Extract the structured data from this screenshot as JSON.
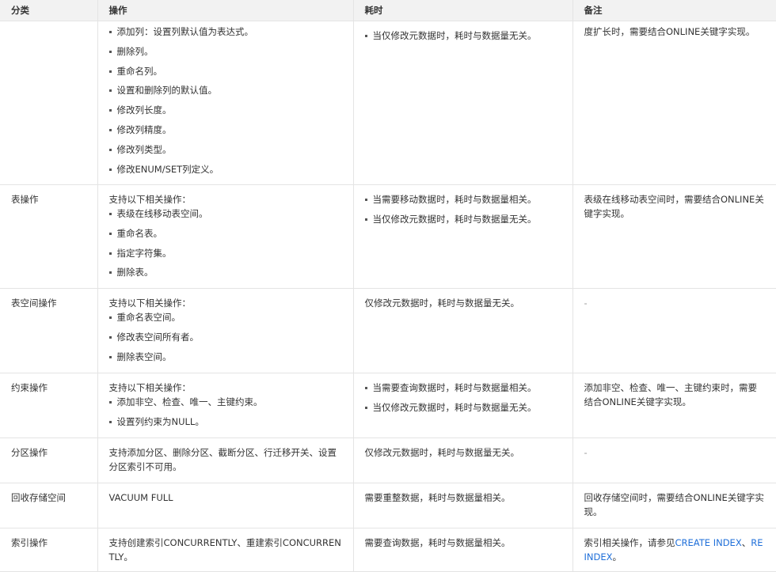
{
  "headers": [
    "分类",
    "操作",
    "耗时",
    "备注"
  ],
  "rows": [
    {
      "category": "",
      "op_intro": "",
      "op_items": [
        "添加列：设置列默认值为表达式。",
        "删除列。",
        "重命名列。",
        "设置和删除列的默认值。",
        "修改列长度。",
        "修改列精度。",
        "修改列类型。",
        "修改ENUM/SET列定义。"
      ],
      "time_items": [
        "当仅修改元数据时，耗时与数据量无关。"
      ],
      "note": "度扩长时，需要结合ONLINE关键字实现。"
    },
    {
      "category": "表操作",
      "op_intro": "支持以下相关操作：",
      "op_items": [
        "表级在线移动表空间。",
        "重命名表。",
        "指定字符集。",
        "删除表。"
      ],
      "time_items": [
        "当需要移动数据时，耗时与数据量相关。",
        "当仅修改元数据时，耗时与数据量无关。"
      ],
      "note": "表级在线移动表空间时，需要结合ONLINE关键字实现。"
    },
    {
      "category": "表空间操作",
      "op_intro": "支持以下相关操作：",
      "op_items": [
        "重命名表空间。",
        "修改表空间所有者。",
        "删除表空间。"
      ],
      "time_text": "仅修改元数据时，耗时与数据量无关。",
      "note": "-"
    },
    {
      "category": "约束操作",
      "op_intro": "支持以下相关操作：",
      "op_items": [
        "添加非空、检查、唯一、主键约束。",
        "设置列约束为NULL。"
      ],
      "time_items": [
        "当需要查询数据时，耗时与数据量相关。",
        "当仅修改元数据时，耗时与数据量无关。"
      ],
      "note": "添加非空、检查、唯一、主键约束时，需要结合ONLINE关键字实现。"
    },
    {
      "category": "分区操作",
      "op_text": "支持添加分区、删除分区、截断分区、行迁移开关、设置分区索引不可用。",
      "time_text": "仅修改元数据时，耗时与数据量无关。",
      "note": "-"
    },
    {
      "category": "回收存储空间",
      "op_text": "VACUUM FULL",
      "time_text": "需要重整数据，耗时与数据量相关。",
      "note": "回收存储空间时，需要结合ONLINE关键字实现。"
    },
    {
      "category": "索引操作",
      "op_text": "支持创建索引CONCURRENTLY、重建索引CONCURRENTLY。",
      "time_text": "需要查询数据，耗时与数据量相关。",
      "note_prefix": "索引相关操作，请参见",
      "note_link1": "CREATE INDEX",
      "note_sep": "、",
      "note_link2": "REINDEX",
      "note_suffix": "。"
    }
  ]
}
